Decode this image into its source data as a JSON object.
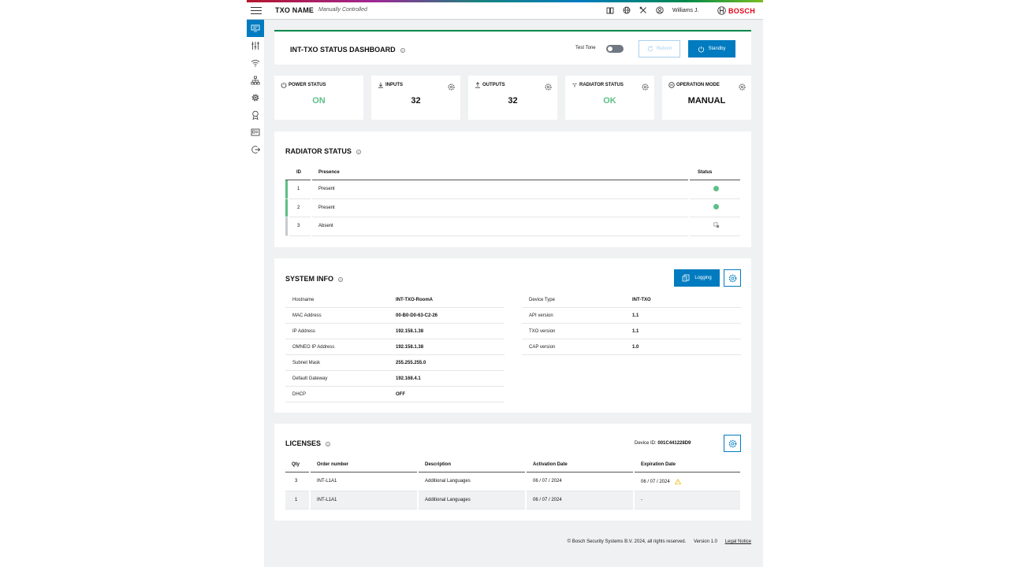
{
  "header": {
    "title": "TXO NAME",
    "subtitle": "Manually Controlled",
    "user": "Williams J.",
    "brand": "BOSCH",
    "icons": [
      "book-icon",
      "globe-icon",
      "tools-icon",
      "user-icon"
    ]
  },
  "sidebar": {
    "items": [
      {
        "icon": "dashboard-icon",
        "active": true
      },
      {
        "icon": "sliders-icon",
        "active": false
      },
      {
        "icon": "wifi-icon",
        "active": false
      },
      {
        "icon": "network-icon",
        "active": false
      },
      {
        "icon": "gear-icon",
        "active": false
      },
      {
        "icon": "certificate-icon",
        "active": false
      },
      {
        "icon": "id-card-icon",
        "active": false
      },
      {
        "icon": "logout-icon",
        "active": false
      }
    ]
  },
  "dashboard": {
    "title": "INT-TXO STATUS DASHBOARD",
    "test_tone_label": "Test Tone",
    "reboot_label": "Reboot",
    "standby_label": "Standby"
  },
  "stats": [
    {
      "label": "POWER STATUS",
      "value": "ON",
      "icon": "power-icon",
      "status_color": "#5dbf87",
      "has_gear": false
    },
    {
      "label": "INPUTS",
      "value": "32",
      "icon": "download-icon",
      "has_gear": true
    },
    {
      "label": "OUTPUTS",
      "value": "32",
      "icon": "upload-icon",
      "has_gear": true
    },
    {
      "label": "RADIATOR STATUS",
      "value": "OK",
      "icon": "radiator-icon",
      "status_color": "#5dbf87",
      "has_gear": true
    },
    {
      "label": "OPERATION MODE",
      "value": "MANUAL",
      "icon": "mode-icon",
      "has_gear": true
    }
  ],
  "radiator": {
    "title": "RADIATOR STATUS",
    "headers": {
      "id": "ID",
      "presence": "Presence",
      "status": "Status"
    },
    "rows": [
      {
        "id": "1",
        "presence": "Present",
        "status": "ok"
      },
      {
        "id": "2",
        "presence": "Present",
        "status": "ok"
      },
      {
        "id": "3",
        "presence": "Absent",
        "status": "absent"
      }
    ]
  },
  "system_info": {
    "title": "SYSTEM INFO",
    "logging_label": "Logging",
    "left": [
      {
        "key": "Hostname",
        "value": "INT-TXO-RoomA"
      },
      {
        "key": "MAC Address",
        "value": "00-B0-D0-63-C2-26"
      },
      {
        "key": "IP Address",
        "value": "192.158.1.38"
      },
      {
        "key": "OMNEO IP Address",
        "value": "192.158.1.38"
      },
      {
        "key": "Subnet Mask",
        "value": "255.255.255.0"
      },
      {
        "key": "Default Gateway",
        "value": "192.168.4.1"
      },
      {
        "key": "DHCP",
        "value": "OFF"
      }
    ],
    "right": [
      {
        "key": "Device Type",
        "value": "INT-TXO"
      },
      {
        "key": "API version",
        "value": "1.1"
      },
      {
        "key": "TXO version",
        "value": "1.1"
      },
      {
        "key": "CAP version",
        "value": "1.0"
      }
    ]
  },
  "licenses": {
    "title": "LICENSES",
    "device_id_label": "Device ID:",
    "device_id": "001C441228D9",
    "headers": {
      "qty": "Qty",
      "order": "Order number",
      "description": "Description",
      "activation": "Activation Date",
      "expiration": "Expiration Date"
    },
    "rows": [
      {
        "qty": "3",
        "order": "INT-L1A1",
        "description": "Additional Languages",
        "activation": "06 / 07 / 2024",
        "expiration": "06 / 07 / 2024",
        "warning": true
      },
      {
        "qty": "1",
        "order": "INT-L1A1",
        "description": "Additional Languages",
        "activation": "06 / 07 / 2024",
        "expiration": "-",
        "warning": false
      }
    ]
  },
  "footer": {
    "copyright": "© Bosch Security Systems B.V. 2024, all rights reserved.",
    "version": "Version 1.0",
    "legal": "Legal Notice"
  },
  "colors": {
    "accent": "#007bc0",
    "success": "#5dbf87",
    "brand": "#e20015",
    "warning": "#e8c21a"
  }
}
